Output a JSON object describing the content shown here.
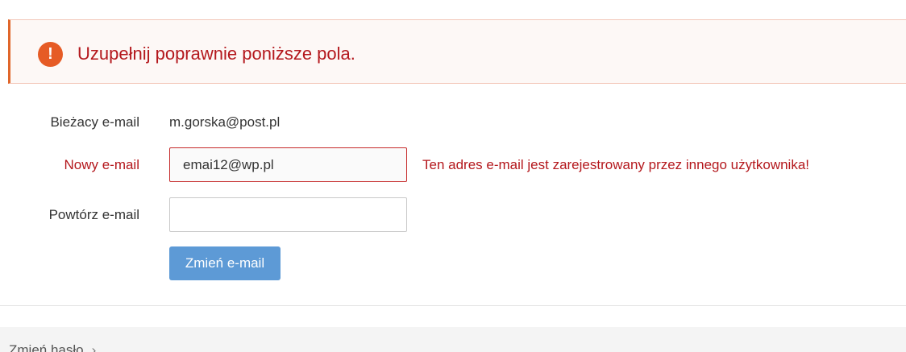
{
  "alert": {
    "icon": "exclamation-circle-icon",
    "message": "Uzupełnij poprawnie poniższe pola."
  },
  "form": {
    "current_email": {
      "label": "Bieżacy e-mail",
      "value": "m.gorska@post.pl"
    },
    "new_email": {
      "label": "Nowy e-mail",
      "value": "emai12@wp.pl",
      "error": "Ten adres e-mail jest zarejestrowany przez innego użytkownika!"
    },
    "repeat_email": {
      "label": "Powtórz e-mail",
      "value": ""
    },
    "submit_label": "Zmień e-mail"
  },
  "bottom": {
    "change_password_label": "Zmień hasło",
    "chevron_icon": "chevron-right-icon",
    "chevron_glyph": "›"
  },
  "colors": {
    "error": "#b4181d",
    "alert_icon": "#e65b25",
    "button": "#5d9ad6"
  }
}
